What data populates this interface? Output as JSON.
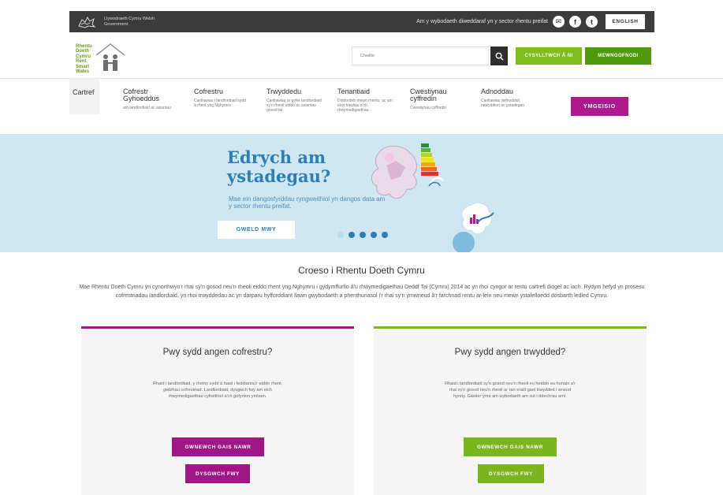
{
  "govbar": {
    "logo_text": "Llywodraeth Cymru Welsh Government",
    "tagline": "Am y wybodaeth diweddaraf yn y sector rhentu preifat",
    "social": [
      {
        "icon": "message-icon",
        "glyph": "✉"
      },
      {
        "icon": "facebook-icon",
        "glyph": "f"
      },
      {
        "icon": "twitter-icon",
        "glyph": "t"
      }
    ],
    "language_label": "ENGLISH"
  },
  "header": {
    "logo_text": "Rhentu Doeth Cymru Rent Smart Wales",
    "search_placeholder": "Chwilio",
    "contact_label": "CYSYLLTWCH Â NI",
    "login_label": "MEWNGOFNODI"
  },
  "nav": {
    "home_label": "Cartref",
    "items": [
      {
        "title": "Cofrestr Gyhoeddus",
        "desc": "am landlordiaid ac asiantau"
      },
      {
        "title": "Cofrestru",
        "desc": "Canllawiau i landlordiaid sydd â rhent yng Nghymru"
      },
      {
        "title": "Trwyddedu",
        "desc": "Canllawiau ar gyfer landlordiaid sy'n rheoli eiddo ac asiantau gosod tai"
      },
      {
        "title": "Tenantiaid",
        "desc": "Diddordeb mewn rhentu, ac am eich hawliau a'ch rhwymedigaethau"
      },
      {
        "title": "Cwestiynau cyffredin",
        "desc": "Cwestiynau cyffredin"
      },
      {
        "title": "Adnoddau",
        "desc": "Canllawiau defnyddiol, newyddion ac ystadegau"
      }
    ],
    "apply_label": "YMGEISIO"
  },
  "hero": {
    "title": "Edrych am ystadegau?",
    "subtitle": "Mae ein dangosfyrddau ryngweithiol yn dangos data am y sector rhentu preifat.",
    "button_label": "GWELD MWY",
    "slide_count": 5,
    "active_slide": 1
  },
  "intro": {
    "title": "Croeso i Rhentu Doeth Cymru",
    "text": "Mae Rhentu Doeth Cymru yn cynorthwyo'r rhai sy'n gosod neu'n rheoli eiddo rhent yng Nghymru i gydymffurfio â'u rhwymedigaethau Deddf Tai (Cymru) 2014 ac yn rhoi cyngor ar rentu cartrefi diogel ac iach. Rydym hefyd yn prosesu cofrestriadau landlordiaid, yn rhoi trwyddedau ac yn darparu hyfforddiant llawn gwybodaeth a phenthunasol i'r rhai sy'n ymwneud â'r farchnad rentu ar-lein neu mewn ystafelloedd dosbarth ledled Cymru."
  },
  "cards": [
    {
      "title": "Pwy sydd angen cofrestru?",
      "text": "Rhaid i landlordiaid, y rheiny sydd â hawl i feddiannu'r eiddo rhent, gwblhau cofrestriad. Landlordiaid, dysgwch fwy am eich rhwymedigaethau cyfreithiol a'ch gofynion ymlaen.",
      "primary_label": "GWNEWCH GAIS NAWR",
      "secondary_label": "DYSGWCH FWY"
    },
    {
      "title": "Pwy sydd angen trwydded?",
      "text": "Rhaid i landlordiaid sy'n gosod neu'n rheoli eu heiddo eu hunain a'r rhai sy'n gosod neu'n rheoli ar ran eraill gael trwydded i wneud hynny. Gweler yma am wybodaeth am sut i ddechrau arni.",
      "primary_label": "GWNEWCH GAIS NAWR",
      "secondary_label": "DYSGWCH FWY"
    }
  ],
  "colors": {
    "purple": "#a01687",
    "green": "#7ab51d",
    "dark_green": "#4e9a0b",
    "blue": "#2b7fb6",
    "hero_bg": "#cfe6f3",
    "govbar": "#3b3b3b"
  }
}
